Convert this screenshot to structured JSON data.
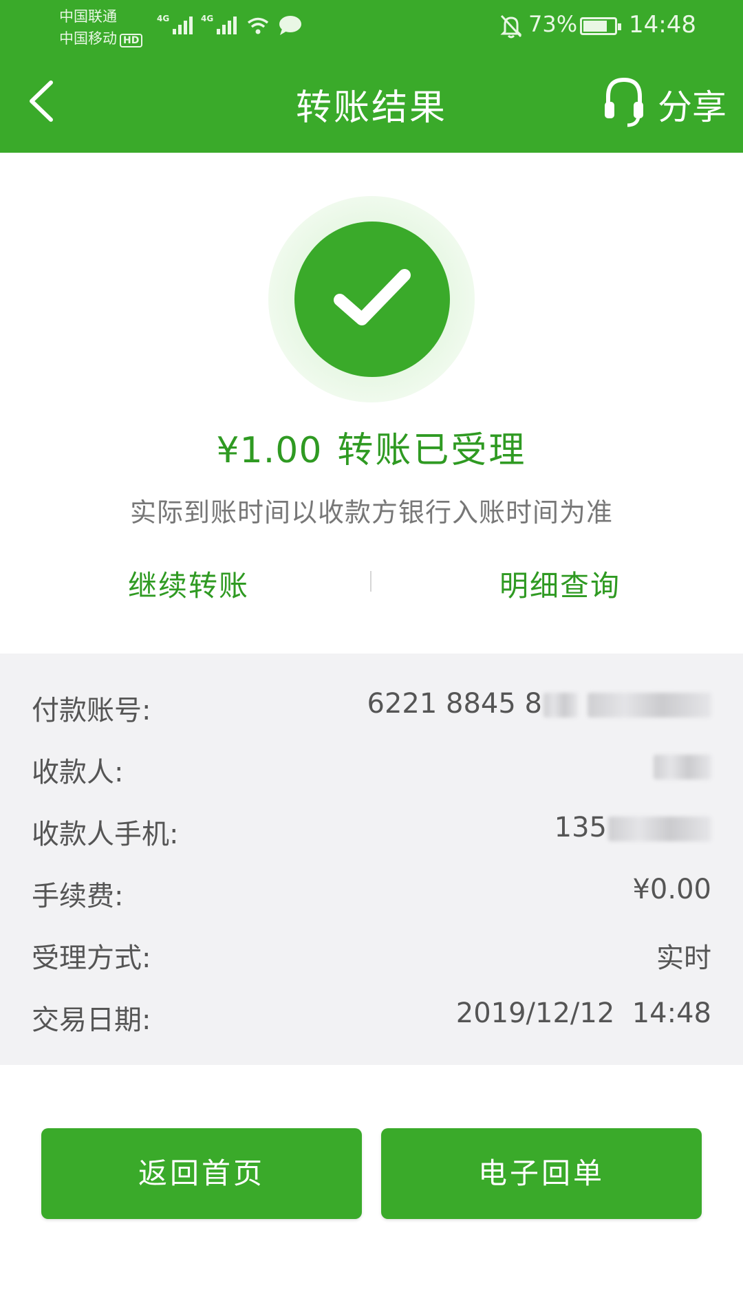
{
  "status_bar": {
    "carrier_1": "中国联通",
    "carrier_2": "中国移动",
    "hd_badge": "HD",
    "network_1": "4G",
    "network_2": "4G",
    "battery": "73%",
    "time": "14:48"
  },
  "header": {
    "title": "转账结果",
    "share_label": "分享",
    "back_icon": "chevron-left-icon",
    "support_icon": "headset-icon"
  },
  "result": {
    "amount": "¥1.00",
    "status": "转账已受理",
    "notice": "实际到账时间以收款方银行入账时间为准",
    "continue_label": "继续转账",
    "detail_label": "明细查询"
  },
  "details": [
    {
      "label": "付款账号:",
      "value": "6221 8845 8"
    },
    {
      "label": "收款人:",
      "value": ""
    },
    {
      "label": "收款人手机:",
      "value": "135"
    },
    {
      "label": "手续费:",
      "value": "¥0.00"
    },
    {
      "label": "受理方式:",
      "value": "实时"
    },
    {
      "label": "交易日期:",
      "value": "2019/12/12  14:48"
    }
  ],
  "buttons": {
    "home": "返回首页",
    "receipt": "电子回单"
  },
  "colors": {
    "brand_green": "#3aaa2a",
    "text_green": "#2f9a22",
    "panel_gray": "#f2f2f4"
  }
}
